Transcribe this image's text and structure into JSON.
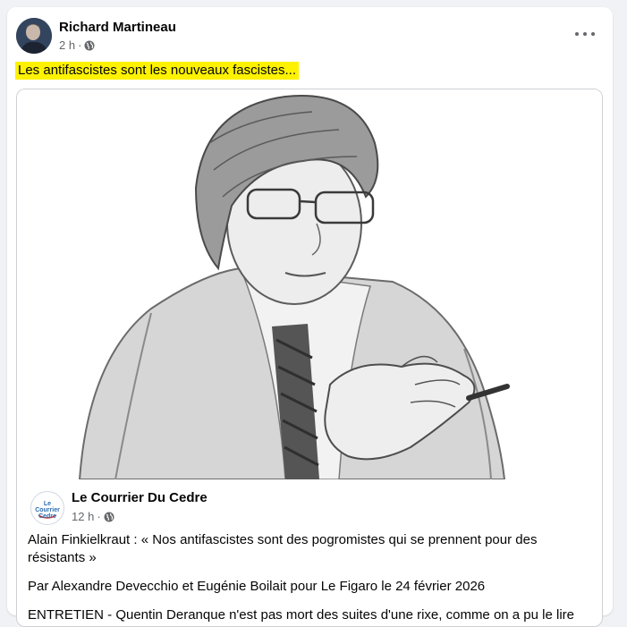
{
  "post": {
    "author": "Richard Martineau",
    "time": "2 h",
    "separator": "·",
    "caption": "Les antifascistes sont les nouveaux fascistes...",
    "icons": {
      "privacy": "globe-icon",
      "menu": "more-options-icon"
    }
  },
  "shared": {
    "page_name": "Le Courrier Du Cedre",
    "logo_text": "Le Courrier Cedre",
    "time": "12 h",
    "separator": "·",
    "paragraphs": [
      "Alain Finkielkraut : « Nos antifascistes sont des pogromistes qui se prennent pour des résistants »",
      "Par Alexandre Devecchio et Eugénie Boilait pour Le Figaro le 24 février 2026",
      "ENTRETIEN - Quentin Deranque n'est pas mort des suites d'une rixe, comme on a pu le lire"
    ]
  },
  "colors": {
    "highlight": "#fef200",
    "secondary_text": "#65676b",
    "background": "#f0f2f5"
  }
}
